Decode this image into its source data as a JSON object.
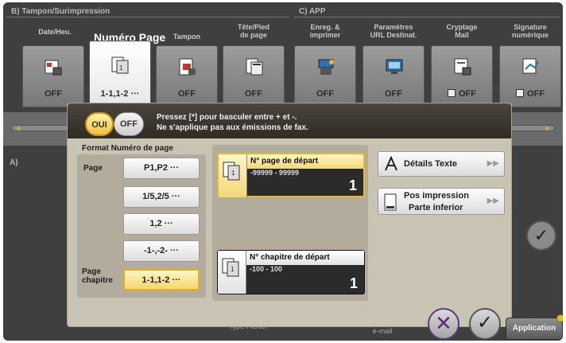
{
  "background": {
    "section_b_title": "B)  Tampon/Surimpression",
    "section_c_title": "C)  APP",
    "active_tab_title": "Numéro Page",
    "tabs": [
      {
        "label": "Date/Heu.",
        "value": "OFF",
        "icon": "date-stamp-icon"
      },
      {
        "label": "",
        "value": "1-1,1-2 ···",
        "icon": "page-number-icon"
      },
      {
        "label": "Tampon",
        "value": "OFF",
        "icon": "stamp-icon"
      },
      {
        "label": "Tête/Pied\nde page",
        "value": "OFF",
        "icon": "header-footer-icon"
      },
      {
        "label": "Enreg. &\nimprimer",
        "value": "OFF",
        "icon": "save-print-icon"
      },
      {
        "label": "Paramètres\nURL Destinat.",
        "value": "OFF",
        "icon": "url-destination-icon"
      },
      {
        "label": "Cryptage\nMail",
        "value": "OFF",
        "icon": "mail-encryption-icon"
      },
      {
        "label": "Signature\nnumérique",
        "value": "OFF",
        "icon": "digital-signature-icon"
      }
    ],
    "a_label": "A)",
    "bottom_left_label": "Type Fichier",
    "bottom_right_label": "Configuration\ne-mail"
  },
  "dialog": {
    "toggle_on": "OUI",
    "toggle_off": "OFF",
    "message_line1": "Pressez [*] pour basculer entre + et -.",
    "message_line2": "Ne s'applique pas aux émissions de fax.",
    "format_title": "Format Numéro de page",
    "page_label": "Page",
    "chapter_label": "Page\nchapitre",
    "formats": [
      "P1,P2 ···",
      "1/5,2/5 ···",
      "1,2 ···",
      "-1-,-2- ···",
      "1-1,1-2 ···"
    ],
    "selected_format_index": 4,
    "start_page": {
      "label": "N° page de départ",
      "range": "-99999 - 99999",
      "value": "1"
    },
    "start_chapter": {
      "label": "N° chapitre de départ",
      "range": "-100 - 100",
      "value": "1"
    },
    "details_text_label": "Détails Texte",
    "print_position_label": "Pos impression",
    "print_position_value": "Parte inferior"
  },
  "footer": {
    "cancel_symbol": "✕",
    "ok_symbol": "✓",
    "application_label": "Application"
  },
  "colors": {
    "accent": "#e8b923",
    "dialog_bg": "#c9c3b4",
    "header_bg": "#2f2b25"
  }
}
